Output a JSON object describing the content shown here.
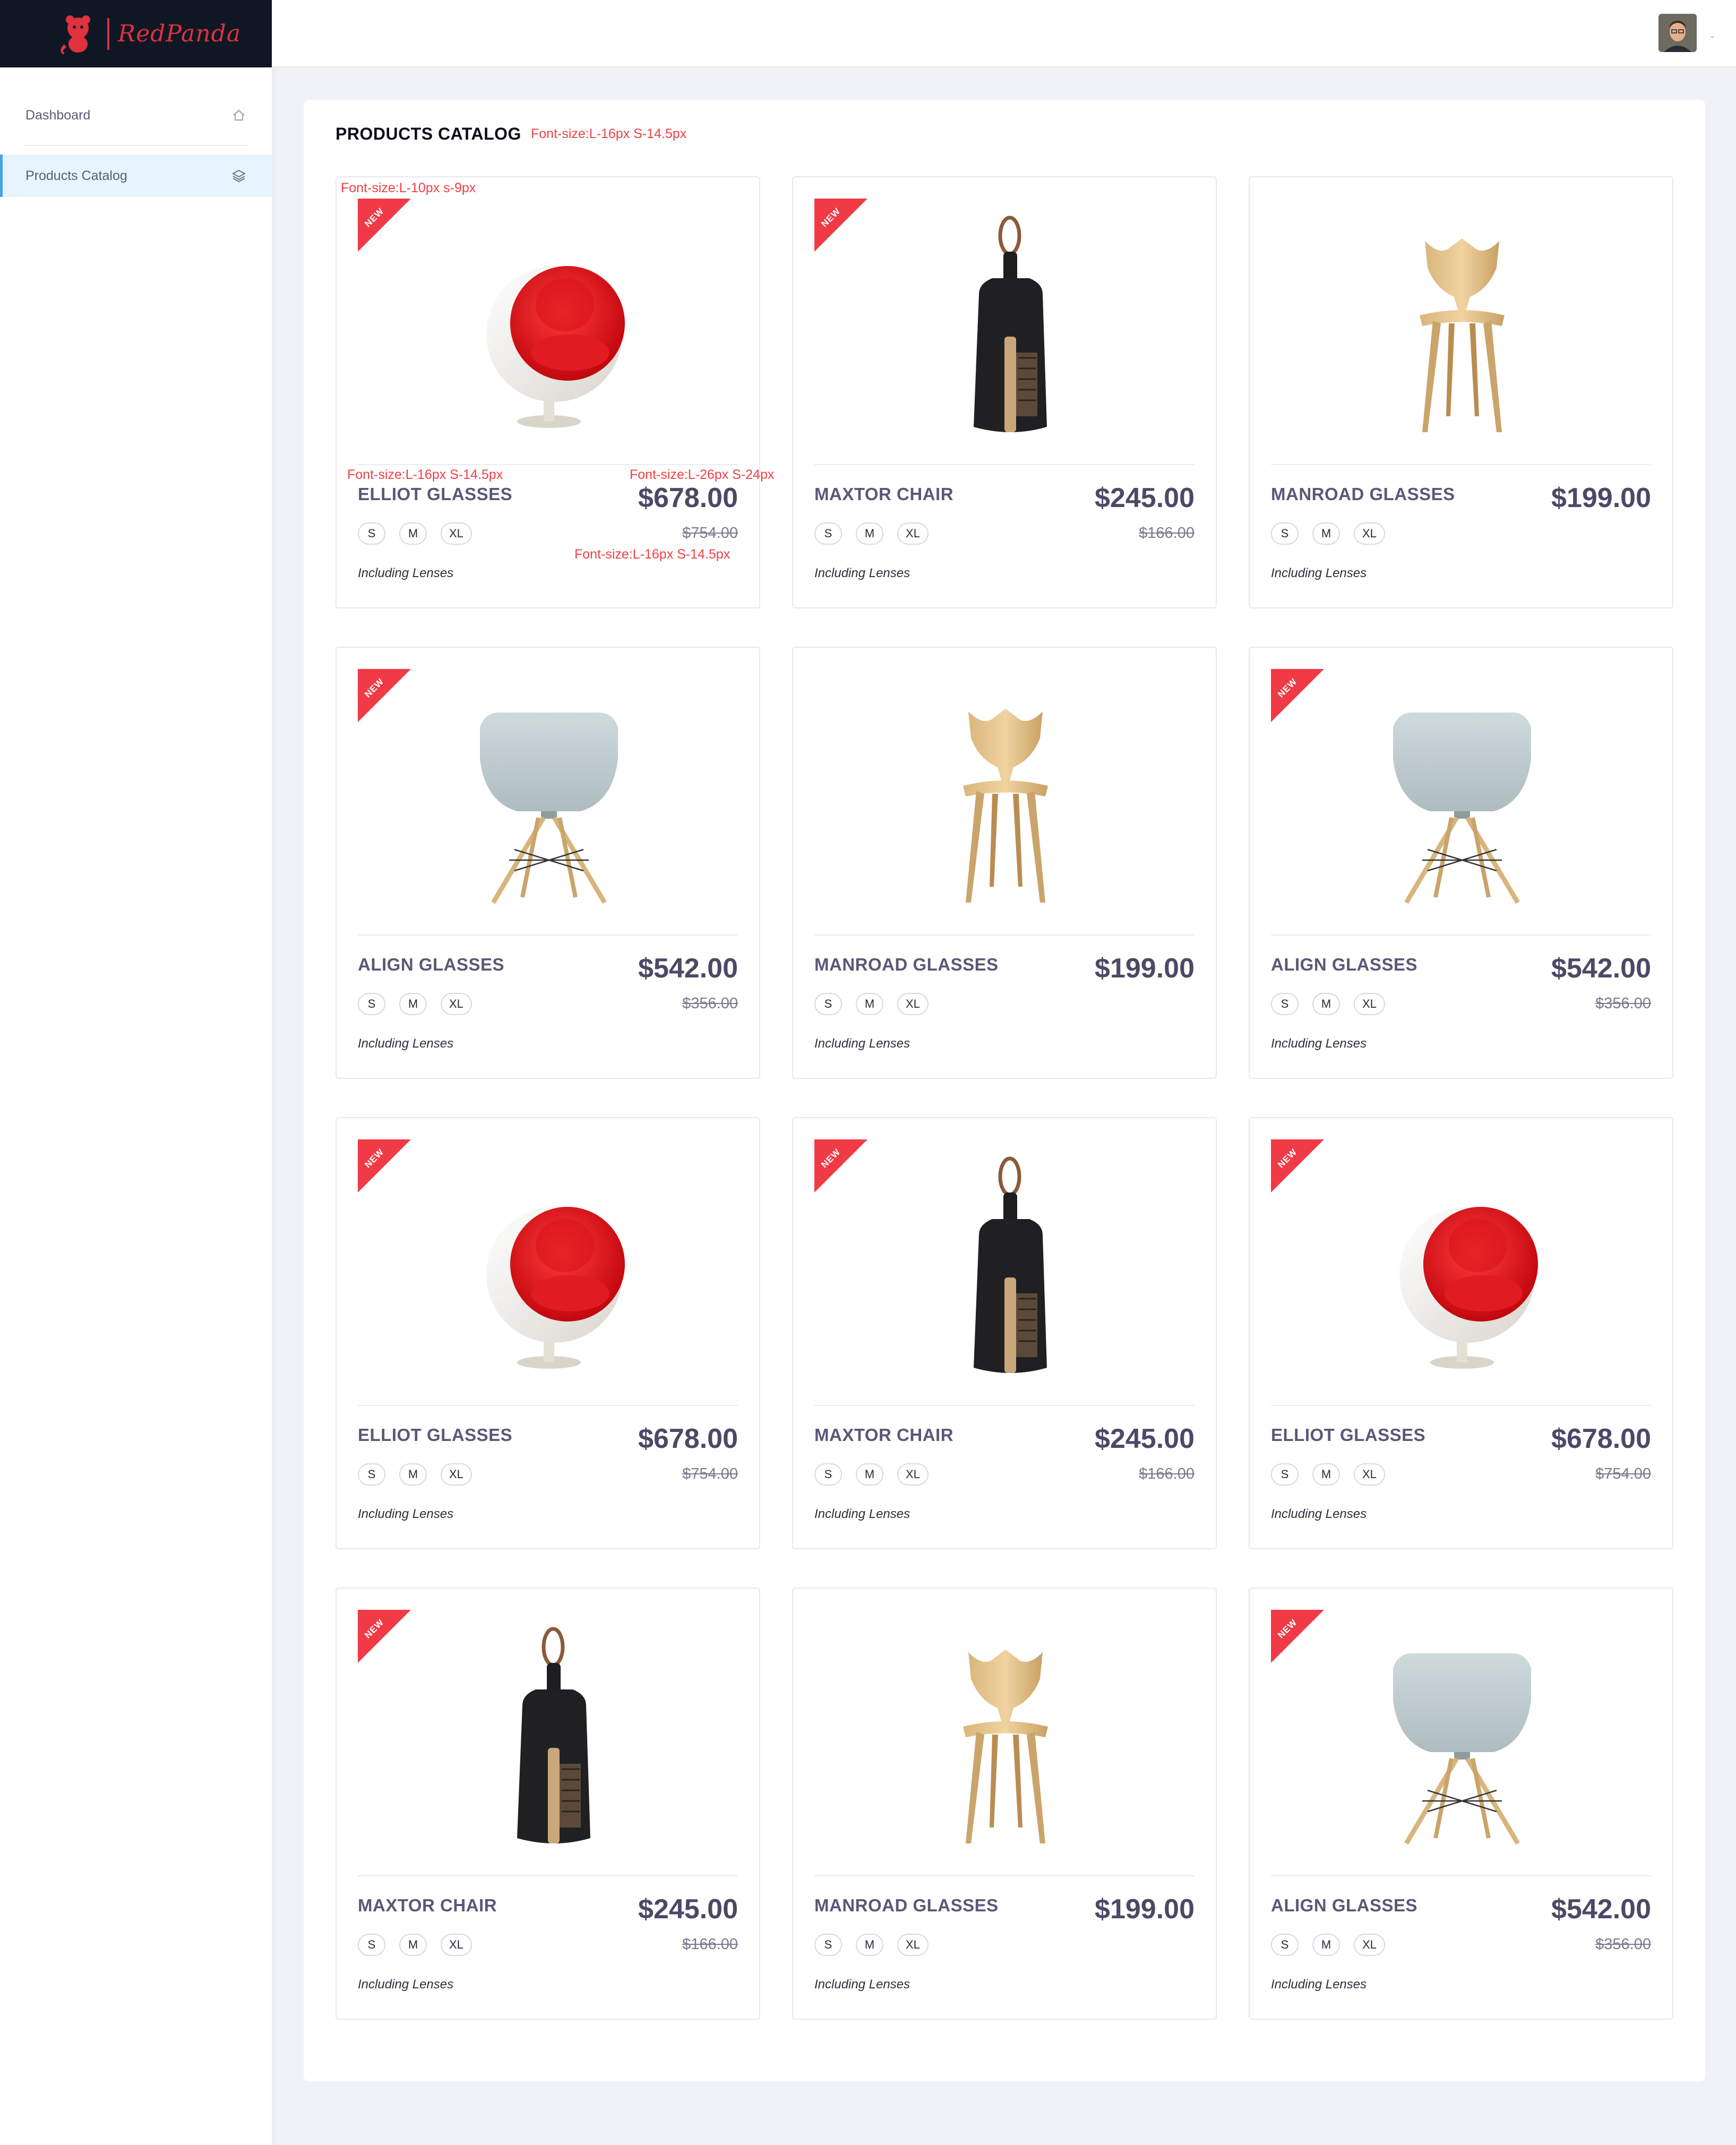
{
  "brand": {
    "name": "RedPanda"
  },
  "sidebar": {
    "items": [
      {
        "label": "Dashboard",
        "icon": "home-icon"
      },
      {
        "label": "Products Catalog",
        "icon": "layers-icon"
      }
    ]
  },
  "header": {
    "avatar": "user-avatar",
    "menu_caret": "⌄"
  },
  "catalog": {
    "title": "PRODUCTS CATALOG",
    "annotations": {
      "title_font": "Font-size:L-16px S-14.5px",
      "badge_font": "Font-size:L-10px s-9px",
      "name_font": "Font-size:L-16px S-14.5px",
      "price_font": "Font-size:L-26px S-24px",
      "old_price_font": "Font-size:L-16px S-14.5px"
    },
    "badge_text": "NEW",
    "lenses_label": "Including Lenses",
    "sizes": [
      "S",
      "M",
      "XL"
    ],
    "products": [
      {
        "name": "ELLIOT GLASSES",
        "price": "$678.00",
        "old_price": "$754.00",
        "is_new": true,
        "image": "egg-chair"
      },
      {
        "name": "MAXTOR CHAIR",
        "price": "$245.00",
        "old_price": "$166.00",
        "is_new": true,
        "image": "dustpan"
      },
      {
        "name": "MANROAD GLASSES",
        "price": "$199.00",
        "old_price": "",
        "is_new": false,
        "image": "wood-chair"
      },
      {
        "name": "ALIGN GLASSES",
        "price": "$542.00",
        "old_price": "$356.00",
        "is_new": true,
        "image": "shell-chair"
      },
      {
        "name": "MANROAD GLASSES",
        "price": "$199.00",
        "old_price": "",
        "is_new": false,
        "image": "wood-chair"
      },
      {
        "name": "ALIGN GLASSES",
        "price": "$542.00",
        "old_price": "$356.00",
        "is_new": true,
        "image": "shell-chair"
      },
      {
        "name": "ELLIOT GLASSES",
        "price": "$678.00",
        "old_price": "$754.00",
        "is_new": true,
        "image": "egg-chair"
      },
      {
        "name": "MAXTOR CHAIR",
        "price": "$245.00",
        "old_price": "$166.00",
        "is_new": true,
        "image": "dustpan"
      },
      {
        "name": "ELLIOT GLASSES",
        "price": "$678.00",
        "old_price": "$754.00",
        "is_new": true,
        "image": "egg-chair"
      },
      {
        "name": "MAXTOR CHAIR",
        "price": "$245.00",
        "old_price": "$166.00",
        "is_new": true,
        "image": "dustpan"
      },
      {
        "name": "MANROAD GLASSES",
        "price": "$199.00",
        "old_price": "",
        "is_new": false,
        "image": "wood-chair"
      },
      {
        "name": "ALIGN GLASSES",
        "price": "$542.00",
        "old_price": "$356.00",
        "is_new": true,
        "image": "shell-chair"
      }
    ]
  },
  "colors": {
    "accent": "#f03a46",
    "active_nav": "#e7f4fd",
    "active_nav_border": "#46a4e2"
  }
}
